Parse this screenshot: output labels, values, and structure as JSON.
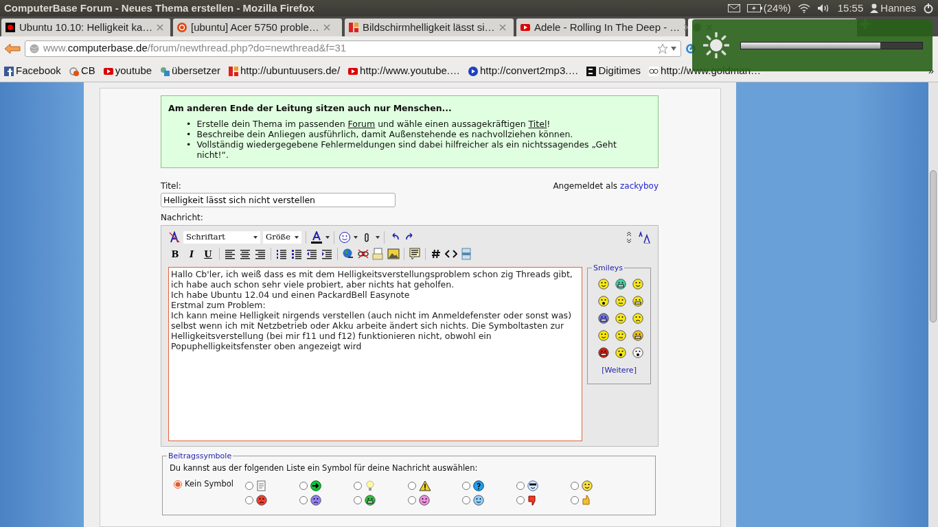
{
  "top_panel": {
    "title": "ComputerBase Forum - Neues Thema erstellen - Mozilla Firefox",
    "battery": "(24%)",
    "clock": "15:55",
    "user": "Hannes"
  },
  "tabs": [
    {
      "title": "Ubuntu 10.10: Helligkeit ka…",
      "selected": false
    },
    {
      "title": "[ubuntu] Acer 5750 proble…",
      "selected": false
    },
    {
      "title": "Bildschirmhelligkeit lässt si…",
      "selected": false
    },
    {
      "title": "Adele - Rolling In The Deep - …",
      "selected": false
    },
    {
      "selected": true
    }
  ],
  "address_bar": {
    "host_prefix": "www.",
    "host": "computerbase.de",
    "path": "/forum/newthread.php?do=newthread&f=31"
  },
  "bookmarks": [
    "Facebook",
    "CB",
    "youtube",
    "übersetzer",
    "http://ubuntuusers.de/",
    "http://www.youtube.…",
    "http://convert2mp3.…",
    "Digitimes",
    "http://www.goldman…"
  ],
  "bookmarks_more": "»",
  "brightness_osd": {
    "level": 0.77
  },
  "notice": {
    "heading": "Am anderen Ende der Leitung sitzen auch nur Menschen...",
    "items": [
      {
        "marker": "•",
        "parts": [
          {
            "text": "Erstelle dein Thema im passenden "
          },
          {
            "text": "Forum",
            "link": true
          },
          {
            "text": " und wähle einen aussagekräftigen "
          },
          {
            "text": "Titel",
            "link": true
          },
          {
            "text": "!"
          }
        ]
      },
      {
        "marker": "•",
        "parts": [
          {
            "text": "Beschreibe dein Anliegen ausführlich, damit Außenstehende es nachvollziehen können."
          }
        ]
      },
      {
        "marker": "•",
        "parts": [
          {
            "text": "Vollständig wiedergegebene Fehlermeldungen sind dabei hilfreicher als ein nichtssagendes „Geht nicht!“."
          }
        ]
      }
    ]
  },
  "form": {
    "title_label": "Titel:",
    "title_value": "Helligkeit lässt sich nicht verstellen",
    "logged_in_prefix": "Angemeldet als",
    "username": "zackyboy",
    "message_label": "Nachricht:"
  },
  "editor": {
    "font_select": "Schriftart",
    "size_select": "Größe",
    "format_buttons": [
      "B",
      "I",
      "U"
    ],
    "message": "Hallo Cb'ler, ich weiß dass es mit dem Helligkeitsverstellungsproblem schon zig Threads gibt, ich habe auch schon sehr viele probiert, aber nichts hat geholfen.\nIch habe Ubuntu 12.04 und einen PackardBell Easynote\nErstmal zum Problem:\nIch kann meine Helligkeit nirgends verstellen (auch nicht im Anmeldefenster oder sonst was) selbst wenn ich mit Netzbetrieb oder Akku arbeite ändert sich nichts. Die Symboltasten zur Helligkeitsverstellung (bei mir f11 und f12) funktionieren nicht, obwohl ein Popuphelligkeitsfenster oben angezeigt wird",
    "smileys_legend": "Smileys",
    "smileys_more": "[Weitere]"
  },
  "post_icons": {
    "legend": "Beitragssymbole",
    "instruction": "Du kannst aus der folgenden Liste ein Symbol für deine Nachricht auswählen:",
    "options": [
      {
        "label": "Kein Symbol",
        "selected": true
      },
      {
        "selected": false
      },
      {
        "selected": false
      },
      {
        "selected": false
      },
      {
        "selected": false
      },
      {
        "selected": false
      },
      {
        "selected": false
      },
      {
        "selected": false
      },
      {
        "selected": false
      },
      {
        "selected": false
      },
      {
        "selected": false
      },
      {
        "selected": false
      },
      {
        "selected": false
      },
      {
        "selected": false
      },
      {
        "selected": false
      }
    ]
  }
}
